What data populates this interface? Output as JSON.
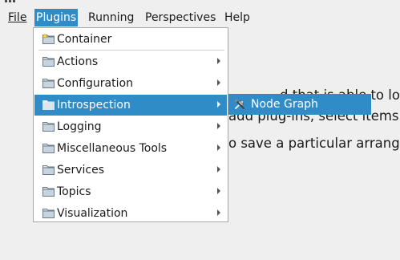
{
  "menubar": {
    "items": [
      {
        "label": "File"
      },
      {
        "label": "Plugins"
      },
      {
        "label": "Running"
      },
      {
        "label": "Perspectives"
      },
      {
        "label": "Help"
      }
    ]
  },
  "background_text": {
    "line1": "d that is able to lo",
    "line2": "add plug-ins, select items",
    "line3": "o save a particular arrange"
  },
  "plugins_menu": {
    "items": [
      {
        "label": "Container",
        "icon": "folder-icon",
        "has_submenu": false
      },
      {
        "label": "Actions",
        "icon": "folder-icon",
        "has_submenu": true
      },
      {
        "label": "Configuration",
        "icon": "folder-icon",
        "has_submenu": true
      },
      {
        "label": "Introspection",
        "icon": "folder-icon",
        "has_submenu": true,
        "highlighted": true
      },
      {
        "label": "Logging",
        "icon": "folder-icon",
        "has_submenu": true
      },
      {
        "label": "Miscellaneous Tools",
        "icon": "folder-icon",
        "has_submenu": true
      },
      {
        "label": "Services",
        "icon": "folder-icon",
        "has_submenu": true
      },
      {
        "label": "Topics",
        "icon": "folder-icon",
        "has_submenu": true
      },
      {
        "label": "Visualization",
        "icon": "folder-icon",
        "has_submenu": true
      }
    ]
  },
  "introspection_submenu": {
    "items": [
      {
        "label": "Node Graph",
        "icon": "tools-icon"
      }
    ]
  },
  "colors": {
    "highlight": "#308cc6",
    "background": "#efefef"
  }
}
